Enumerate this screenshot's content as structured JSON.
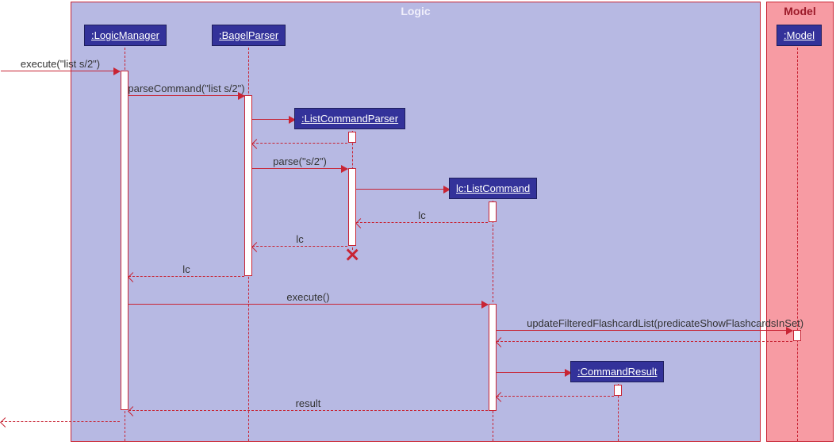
{
  "frames": {
    "logic": "Logic",
    "model": "Model"
  },
  "participants": {
    "logicManager": ":LogicManager",
    "bagelParser": ":BagelParser",
    "listCommandParser": ":ListCommandParser",
    "listCommand": "lc:ListCommand",
    "commandResult": ":CommandResult",
    "model": ":Model"
  },
  "messages": {
    "m1": "execute(\"list s/2\")",
    "m2": "parseCommand(\"list s/2\")",
    "m3": "parse(\"s/2\")",
    "r_lc1": "lc",
    "r_lc2": "lc",
    "r_lc3": "lc",
    "m_execute": "execute()",
    "m_update": "updateFilteredFlashcardList(predicateShowFlashcardsInSet)",
    "r_result": "result"
  }
}
